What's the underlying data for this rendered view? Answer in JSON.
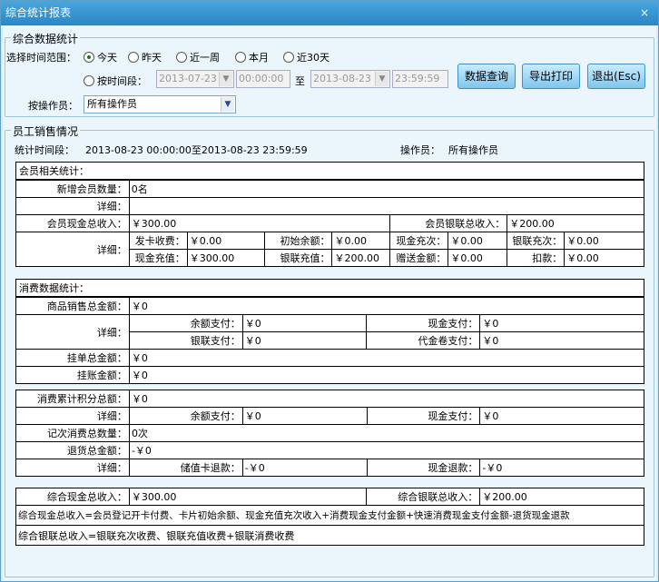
{
  "window": {
    "title": "综合统计报表",
    "close": "×"
  },
  "stats": {
    "legend": "综合数据统计",
    "range_label": "选择时间范围：",
    "opt_today": "今天",
    "opt_yesterday": "昨天",
    "opt_week": "近一周",
    "opt_month": "本月",
    "opt_30": "近30天",
    "opt_period": "按时间段：",
    "start_date": "2013-07-23",
    "start_time": "00:00:00",
    "to": "至",
    "end_date": "2013-08-23",
    "end_time": "23:59:59",
    "btn_query": "数据查询",
    "btn_print": "导出打印",
    "btn_exit": "退出(Esc)",
    "operator_label": "按操作员：",
    "operator_value": "所有操作员"
  },
  "sales": {
    "legend": "员工销售情况",
    "period_label": "统计时间段：",
    "period_value": "2013-08-23 00:00:00至2013-08-23 23:59:59",
    "operator_label": "操作员：",
    "operator_value": "所有操作员"
  },
  "member": {
    "header": "会员相关统计：",
    "new_label": "新增会员数量：",
    "new_value": "0名",
    "detail_label": "详细：",
    "cash_total_label": "会员现金总收入：",
    "cash_total": "￥300.00",
    "union_total_label": "会员银联总收入：",
    "union_total": "￥200.00",
    "card_fee_label": "发卡收费：",
    "card_fee": "￥0.00",
    "init_bal_label": "初始余额：",
    "init_bal": "￥0.00",
    "cash_times_label": "现金充次：",
    "cash_times": "￥0.00",
    "union_times_label": "银联充次：",
    "union_times": "￥0.00",
    "cash_charge_label": "现金充值：",
    "cash_charge": "￥300.00",
    "union_charge_label": "银联充值：",
    "union_charge": "￥200.00",
    "gift_label": "赠送金额：",
    "gift": "￥0.00",
    "deduct_label": "扣款：",
    "deduct": "￥0.00"
  },
  "consume": {
    "header": "消费数据统计：",
    "goods_label": "商品销售总金额：",
    "goods": "￥0",
    "detail_label": "详细：",
    "balance_pay_label": "余额支付：",
    "balance_pay": "￥0",
    "cash_pay_label": "现金支付：",
    "cash_pay": "￥0",
    "union_pay_label": "银联支付：",
    "union_pay": "￥0",
    "voucher_pay_label": "代金卷支付：",
    "voucher_pay": "￥0",
    "hang_label": "挂单总金额：",
    "hang": "￥0",
    "credit_label": "挂账金额：",
    "credit": "￥0"
  },
  "points": {
    "total_label": "消费累计积分总额：",
    "total": "￥0",
    "detail_label": "详细：",
    "balance_pay_label": "余额支付：",
    "balance_pay": "￥0",
    "cash_pay_label": "现金支付：",
    "cash_pay": "￥0",
    "count_label": "记次消费总数量：",
    "count": "0次",
    "refund_label": "退货总金额：",
    "refund": "-￥0",
    "card_refund_label": "储值卡退款：",
    "card_refund": "-￥0",
    "cash_refund_label": "现金退款：",
    "cash_refund": "-￥0"
  },
  "summary": {
    "cash_label": "综合现金总收入：",
    "cash": "￥300.00",
    "union_label": "综合银联总收入：",
    "union": "￥200.00",
    "cash_formula": "综合现金总收入=会员登记开卡付费、卡片初始余额、现金充值充次收入+消费现金支付金额+快速消费现金支付金额-退货现金退款",
    "union_formula": "综合银联总收入=银联充次收费、银联充值收费+银联消费收费"
  }
}
